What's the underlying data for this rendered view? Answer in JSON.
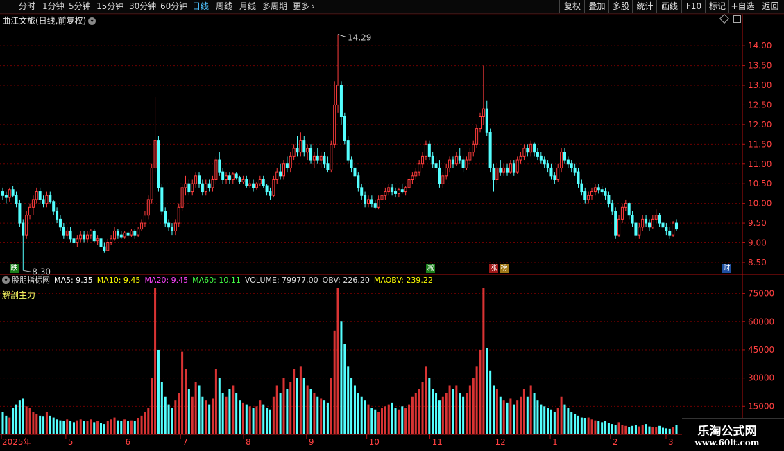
{
  "toolbar": {
    "periods": [
      {
        "label": "分时",
        "active": false
      },
      {
        "label": "1分钟",
        "active": false
      },
      {
        "label": "5分钟",
        "active": false
      },
      {
        "label": "15分钟",
        "active": false
      },
      {
        "label": "30分钟",
        "active": false
      },
      {
        "label": "60分钟",
        "active": false
      },
      {
        "label": "日线",
        "active": true
      },
      {
        "label": "周线",
        "active": false
      },
      {
        "label": "月线",
        "active": false
      },
      {
        "label": "多周期",
        "active": false
      },
      {
        "label": "更多",
        "active": false
      }
    ],
    "more_arrow": "›",
    "right_buttons": [
      "复权",
      "叠加",
      "多股",
      "统计",
      "画线",
      "F10",
      "标记",
      "+自选",
      "返回"
    ]
  },
  "stock": {
    "title": "曲江文旅(日线,前复权)"
  },
  "price_pane": {
    "y_ticks": [
      "14.00",
      "13.50",
      "13.00",
      "12.50",
      "12.00",
      "11.50",
      "11.00",
      "10.50",
      "10.00",
      "9.50",
      "9.00",
      "8.50"
    ],
    "high_label": "14.29",
    "low_label": "8.30"
  },
  "event_markers": [
    {
      "text": "跌",
      "color": "#1a7d1a"
    },
    {
      "text": "减",
      "color": "#1a7d1a"
    },
    {
      "text": "涨",
      "color": "#a01818"
    },
    {
      "text": "榜",
      "color": "#a07818"
    },
    {
      "text": "财",
      "color": "#1f4fa0"
    }
  ],
  "indicator": {
    "name": "股朋指标网",
    "ma5": "MA5: 9.35",
    "ma10": "MA10: 9.45",
    "ma20": "MA20: 9.45",
    "ma60": "MA60: 10.11",
    "volume": "VOLUME: 79977.00",
    "obv": "OBV: 226.20",
    "maobv": "MAOBV: 239.22",
    "sub_label": "解剖主力",
    "colors": {
      "ma5": "#ffffff",
      "ma10": "#ffff00",
      "ma20": "#ff44ff",
      "ma60": "#44ff44",
      "text": "#dddddd"
    }
  },
  "volume_pane": {
    "y_ticks": [
      "75000",
      "60000",
      "45000",
      "30000",
      "15000"
    ]
  },
  "x_axis": {
    "labels": [
      "2025年",
      "5",
      "6",
      "7",
      "8",
      "9",
      "10",
      "11",
      "12",
      "1",
      "2",
      "3"
    ]
  },
  "watermark": {
    "title": "乐淘公式网",
    "url": "www.60lt.com"
  },
  "colors": {
    "up": "#ff3c3c",
    "up_fill": "#000000",
    "down": "#54ffff",
    "grid": "#6e0000",
    "axis": "#b01010",
    "axis_text": "#ff4040"
  },
  "chart_data": {
    "type": "candlestick",
    "y_range": [
      8.2,
      14.6
    ],
    "volume_range": [
      0,
      80000
    ],
    "candles": [
      [
        10.3,
        10.4,
        10.1,
        10.2
      ],
      [
        10.2,
        10.3,
        10.0,
        10.15
      ],
      [
        10.15,
        10.4,
        10.05,
        10.35
      ],
      [
        10.35,
        10.45,
        10.15,
        10.2
      ],
      [
        10.2,
        10.3,
        9.9,
        10.0
      ],
      [
        10.0,
        10.1,
        9.4,
        9.5
      ],
      [
        9.5,
        9.6,
        8.3,
        9.2
      ],
      [
        9.2,
        9.8,
        9.1,
        9.7
      ],
      [
        9.7,
        10.0,
        9.6,
        9.9
      ],
      [
        9.9,
        10.2,
        9.7,
        10.1
      ],
      [
        10.1,
        10.4,
        10.0,
        10.3
      ],
      [
        10.3,
        10.4,
        10.0,
        10.1
      ],
      [
        10.1,
        10.2,
        9.9,
        10.0
      ],
      [
        10.0,
        10.3,
        9.9,
        10.2
      ],
      [
        10.2,
        10.3,
        10.0,
        10.05
      ],
      [
        10.05,
        10.1,
        9.7,
        9.8
      ],
      [
        9.8,
        9.9,
        9.5,
        9.6
      ],
      [
        9.6,
        9.7,
        9.3,
        9.4
      ],
      [
        9.4,
        9.5,
        9.1,
        9.2
      ],
      [
        9.2,
        9.4,
        9.1,
        9.3
      ],
      [
        9.3,
        9.4,
        9.0,
        9.1
      ],
      [
        9.1,
        9.2,
        8.9,
        9.0
      ],
      [
        9.0,
        9.2,
        8.9,
        9.1
      ],
      [
        9.1,
        9.3,
        9.0,
        9.2
      ],
      [
        9.2,
        9.3,
        9.0,
        9.1
      ],
      [
        9.1,
        9.3,
        9.0,
        9.2
      ],
      [
        9.2,
        9.35,
        9.1,
        9.3
      ],
      [
        9.3,
        9.35,
        9.0,
        9.05
      ],
      [
        9.05,
        9.2,
        8.95,
        9.1
      ],
      [
        9.1,
        9.2,
        8.8,
        8.9
      ],
      [
        8.9,
        9.0,
        8.75,
        8.8
      ],
      [
        8.8,
        9.1,
        8.8,
        9.0
      ],
      [
        9.0,
        9.2,
        8.95,
        9.1
      ],
      [
        9.1,
        9.4,
        9.05,
        9.3
      ],
      [
        9.3,
        9.35,
        9.1,
        9.2
      ],
      [
        9.2,
        9.3,
        9.1,
        9.15
      ],
      [
        9.15,
        9.3,
        9.1,
        9.25
      ],
      [
        9.25,
        9.3,
        9.1,
        9.2
      ],
      [
        9.2,
        9.35,
        9.15,
        9.3
      ],
      [
        9.3,
        9.35,
        9.1,
        9.2
      ],
      [
        9.2,
        9.4,
        9.15,
        9.35
      ],
      [
        9.35,
        9.6,
        9.3,
        9.5
      ],
      [
        9.5,
        9.8,
        9.4,
        9.7
      ],
      [
        9.7,
        10.2,
        9.6,
        10.1
      ],
      [
        10.1,
        11.0,
        10.0,
        10.9
      ],
      [
        10.9,
        12.7,
        10.8,
        11.6
      ],
      [
        11.6,
        11.7,
        10.3,
        10.4
      ],
      [
        10.4,
        10.5,
        9.7,
        9.8
      ],
      [
        9.8,
        9.9,
        9.4,
        9.5
      ],
      [
        9.5,
        9.6,
        9.3,
        9.4
      ],
      [
        9.4,
        9.5,
        9.2,
        9.3
      ],
      [
        9.3,
        9.6,
        9.2,
        9.5
      ],
      [
        9.5,
        10.0,
        9.4,
        9.9
      ],
      [
        9.9,
        10.5,
        9.8,
        10.4
      ],
      [
        10.4,
        10.7,
        10.2,
        10.5
      ],
      [
        10.5,
        10.6,
        10.2,
        10.3
      ],
      [
        10.3,
        10.6,
        10.2,
        10.5
      ],
      [
        10.5,
        10.8,
        10.4,
        10.7
      ],
      [
        10.7,
        10.8,
        10.4,
        10.5
      ],
      [
        10.5,
        10.6,
        10.2,
        10.3
      ],
      [
        10.3,
        10.6,
        10.2,
        10.5
      ],
      [
        10.5,
        10.6,
        10.3,
        10.4
      ],
      [
        10.4,
        10.7,
        10.3,
        10.6
      ],
      [
        10.6,
        11.2,
        10.5,
        11.1
      ],
      [
        11.1,
        11.3,
        10.7,
        10.8
      ],
      [
        10.8,
        10.9,
        10.5,
        10.6
      ],
      [
        10.6,
        10.8,
        10.5,
        10.7
      ],
      [
        10.7,
        10.8,
        10.5,
        10.6
      ],
      [
        10.6,
        10.8,
        10.5,
        10.75
      ],
      [
        10.75,
        10.8,
        10.6,
        10.65
      ],
      [
        10.65,
        10.7,
        10.5,
        10.55
      ],
      [
        10.55,
        10.7,
        10.5,
        10.6
      ],
      [
        10.6,
        10.7,
        10.4,
        10.45
      ],
      [
        10.45,
        10.6,
        10.4,
        10.5
      ],
      [
        10.5,
        10.6,
        10.3,
        10.4
      ],
      [
        10.4,
        10.55,
        10.35,
        10.5
      ],
      [
        10.5,
        10.7,
        10.45,
        10.6
      ],
      [
        10.6,
        10.7,
        10.4,
        10.45
      ],
      [
        10.45,
        10.5,
        10.2,
        10.3
      ],
      [
        10.3,
        10.4,
        10.1,
        10.2
      ],
      [
        10.2,
        10.7,
        10.15,
        10.6
      ],
      [
        10.6,
        10.9,
        10.5,
        10.8
      ],
      [
        10.8,
        11.0,
        10.6,
        10.7
      ],
      [
        10.7,
        11.1,
        10.6,
        11.0
      ],
      [
        11.0,
        11.2,
        10.8,
        10.9
      ],
      [
        10.9,
        11.3,
        10.8,
        11.2
      ],
      [
        11.2,
        11.5,
        11.1,
        11.4
      ],
      [
        11.4,
        11.7,
        11.2,
        11.3
      ],
      [
        11.3,
        11.8,
        11.2,
        11.6
      ],
      [
        11.6,
        11.7,
        11.2,
        11.3
      ],
      [
        11.3,
        11.5,
        11.1,
        11.4
      ],
      [
        11.4,
        11.5,
        11.0,
        11.1
      ],
      [
        11.1,
        11.3,
        10.9,
        11.2
      ],
      [
        11.2,
        11.4,
        11.0,
        11.1
      ],
      [
        11.1,
        11.3,
        10.9,
        11.2
      ],
      [
        11.2,
        11.3,
        10.9,
        11.0
      ],
      [
        11.0,
        11.2,
        10.8,
        10.85
      ],
      [
        10.85,
        11.6,
        10.8,
        11.5
      ],
      [
        11.5,
        13.1,
        11.4,
        12.5
      ],
      [
        12.5,
        14.29,
        12.3,
        13.0
      ],
      [
        13.0,
        13.1,
        12.0,
        12.2
      ],
      [
        12.2,
        12.3,
        11.5,
        11.6
      ],
      [
        11.6,
        11.7,
        11.0,
        11.1
      ],
      [
        11.1,
        11.2,
        10.8,
        10.9
      ],
      [
        10.9,
        11.0,
        10.6,
        10.7
      ],
      [
        10.7,
        10.8,
        10.3,
        10.4
      ],
      [
        10.4,
        10.5,
        10.1,
        10.2
      ],
      [
        10.2,
        10.3,
        9.9,
        10.0
      ],
      [
        10.0,
        10.2,
        9.9,
        10.1
      ],
      [
        10.1,
        10.2,
        9.9,
        10.0
      ],
      [
        10.0,
        10.1,
        9.85,
        9.9
      ],
      [
        9.9,
        10.2,
        9.85,
        10.1
      ],
      [
        10.1,
        10.3,
        10.0,
        10.2
      ],
      [
        10.2,
        10.4,
        10.1,
        10.3
      ],
      [
        10.3,
        10.5,
        10.2,
        10.4
      ],
      [
        10.4,
        10.5,
        10.2,
        10.3
      ],
      [
        10.3,
        10.4,
        10.15,
        10.25
      ],
      [
        10.25,
        10.4,
        10.15,
        10.35
      ],
      [
        10.35,
        10.5,
        10.25,
        10.3
      ],
      [
        10.3,
        10.45,
        10.2,
        10.4
      ],
      [
        10.4,
        10.7,
        10.35,
        10.6
      ],
      [
        10.6,
        10.8,
        10.5,
        10.7
      ],
      [
        10.7,
        10.9,
        10.6,
        10.8
      ],
      [
        10.8,
        11.1,
        10.7,
        11.0
      ],
      [
        11.0,
        11.3,
        10.9,
        11.2
      ],
      [
        11.2,
        11.6,
        11.1,
        11.5
      ],
      [
        11.5,
        11.6,
        11.1,
        11.2
      ],
      [
        11.2,
        11.3,
        10.9,
        11.0
      ],
      [
        11.0,
        11.2,
        10.8,
        10.9
      ],
      [
        10.9,
        11.1,
        10.4,
        10.5
      ],
      [
        10.5,
        10.8,
        10.4,
        10.7
      ],
      [
        10.7,
        11.0,
        10.6,
        10.9
      ],
      [
        10.9,
        11.2,
        10.8,
        11.1
      ],
      [
        11.1,
        11.2,
        10.9,
        11.0
      ],
      [
        11.0,
        11.3,
        10.95,
        11.2
      ],
      [
        11.2,
        11.4,
        11.0,
        11.1
      ],
      [
        11.1,
        11.2,
        10.8,
        10.9
      ],
      [
        10.9,
        11.2,
        10.85,
        11.1
      ],
      [
        11.1,
        11.4,
        11.0,
        11.3
      ],
      [
        11.3,
        11.6,
        11.2,
        11.5
      ],
      [
        11.5,
        12.0,
        11.4,
        11.9
      ],
      [
        11.9,
        12.3,
        11.8,
        12.2
      ],
      [
        12.2,
        13.5,
        12.0,
        12.4
      ],
      [
        12.4,
        12.6,
        11.7,
        11.8
      ],
      [
        11.8,
        11.9,
        10.8,
        10.9
      ],
      [
        10.9,
        11.0,
        10.3,
        10.6
      ],
      [
        10.6,
        11.0,
        10.5,
        10.9
      ],
      [
        10.9,
        11.1,
        10.7,
        10.8
      ],
      [
        10.8,
        11.0,
        10.7,
        10.9
      ],
      [
        10.9,
        11.0,
        10.7,
        10.8
      ],
      [
        10.8,
        11.1,
        10.75,
        11.0
      ],
      [
        11.0,
        11.1,
        10.7,
        10.8
      ],
      [
        10.8,
        11.2,
        10.75,
        11.1
      ],
      [
        11.1,
        11.3,
        11.0,
        11.2
      ],
      [
        11.2,
        11.5,
        11.1,
        11.4
      ],
      [
        11.4,
        11.5,
        11.2,
        11.3
      ],
      [
        11.3,
        11.6,
        11.2,
        11.5
      ],
      [
        11.5,
        11.55,
        11.2,
        11.3
      ],
      [
        11.3,
        11.4,
        11.1,
        11.2
      ],
      [
        11.2,
        11.3,
        11.0,
        11.1
      ],
      [
        11.1,
        11.2,
        10.9,
        11.0
      ],
      [
        11.0,
        11.1,
        10.8,
        10.9
      ],
      [
        10.9,
        11.0,
        10.6,
        10.7
      ],
      [
        10.7,
        10.8,
        10.5,
        10.6
      ],
      [
        10.6,
        11.0,
        10.55,
        10.9
      ],
      [
        10.9,
        11.4,
        10.8,
        11.3
      ],
      [
        11.3,
        11.4,
        11.0,
        11.1
      ],
      [
        11.1,
        11.2,
        10.9,
        11.0
      ],
      [
        11.0,
        11.1,
        10.8,
        10.9
      ],
      [
        10.9,
        11.0,
        10.7,
        10.8
      ],
      [
        10.8,
        10.9,
        10.4,
        10.5
      ],
      [
        10.5,
        10.6,
        10.2,
        10.3
      ],
      [
        10.3,
        10.4,
        10.0,
        10.1
      ],
      [
        10.1,
        10.3,
        10.0,
        10.2
      ],
      [
        10.2,
        10.4,
        10.1,
        10.3
      ],
      [
        10.3,
        10.5,
        10.2,
        10.4
      ],
      [
        10.4,
        10.5,
        10.25,
        10.35
      ],
      [
        10.35,
        10.45,
        10.2,
        10.3
      ],
      [
        10.3,
        10.4,
        10.1,
        10.2
      ],
      [
        10.2,
        10.3,
        9.9,
        10.0
      ],
      [
        10.0,
        10.1,
        9.7,
        9.8
      ],
      [
        9.8,
        9.9,
        9.1,
        9.2
      ],
      [
        9.2,
        9.7,
        9.15,
        9.6
      ],
      [
        9.6,
        10.0,
        9.5,
        9.9
      ],
      [
        9.9,
        10.1,
        9.8,
        10.0
      ],
      [
        10.0,
        10.05,
        9.6,
        9.7
      ],
      [
        9.7,
        9.8,
        9.4,
        9.5
      ],
      [
        9.5,
        9.6,
        9.1,
        9.2
      ],
      [
        9.2,
        9.5,
        9.1,
        9.4
      ],
      [
        9.4,
        9.7,
        9.3,
        9.6
      ],
      [
        9.6,
        9.7,
        9.4,
        9.5
      ],
      [
        9.5,
        9.6,
        9.3,
        9.4
      ],
      [
        9.4,
        9.7,
        9.35,
        9.6
      ],
      [
        9.6,
        9.85,
        9.5,
        9.7
      ],
      [
        9.7,
        9.75,
        9.4,
        9.5
      ],
      [
        9.5,
        9.6,
        9.3,
        9.4
      ],
      [
        9.4,
        9.5,
        9.2,
        9.3
      ],
      [
        9.3,
        9.4,
        9.1,
        9.2
      ],
      [
        9.2,
        9.55,
        9.15,
        9.5
      ],
      [
        9.5,
        9.6,
        9.3,
        9.35
      ]
    ],
    "volumes": [
      12000,
      10000,
      9000,
      14000,
      16000,
      18000,
      19000,
      15000,
      14000,
      12000,
      11000,
      10000,
      9500,
      12000,
      10000,
      9000,
      8000,
      7500,
      7000,
      8000,
      7000,
      6500,
      7500,
      8000,
      7000,
      7200,
      8000,
      6500,
      7000,
      6000,
      5500,
      7000,
      8000,
      9000,
      7500,
      7000,
      8000,
      7000,
      7500,
      7000,
      8500,
      10000,
      12000,
      14000,
      30000,
      78000,
      45000,
      28000,
      20000,
      16000,
      14000,
      18000,
      22000,
      44000,
      35000,
      24000,
      20000,
      28000,
      26000,
      20000,
      18000,
      16000,
      19000,
      35000,
      30000,
      22000,
      20000,
      24000,
      26000,
      22000,
      18000,
      17000,
      16000,
      15000,
      14000,
      15000,
      18000,
      16000,
      14000,
      13000,
      20000,
      26000,
      22000,
      30000,
      24000,
      28000,
      35000,
      30000,
      36000,
      30000,
      26000,
      24000,
      22000,
      20000,
      19000,
      18000,
      17000,
      30000,
      55000,
      78000,
      60000,
      48000,
      36000,
      30000,
      26000,
      22000,
      20000,
      18000,
      16000,
      14000,
      13000,
      12000,
      14000,
      15000,
      16000,
      17000,
      14000,
      13000,
      15000,
      14000,
      16000,
      20000,
      22000,
      24000,
      28000,
      36000,
      30000,
      24000,
      22000,
      18000,
      20000,
      22000,
      26000,
      24000,
      26000,
      22000,
      20000,
      22000,
      26000,
      30000,
      36000,
      45000,
      78000,
      46000,
      34000,
      26000,
      24000,
      20000,
      18000,
      17000,
      19000,
      16000,
      18000,
      20000,
      24000,
      20000,
      26000,
      22000,
      18000,
      16000,
      15000,
      14000,
      13000,
      12000,
      14000,
      20000,
      16000,
      14000,
      12000,
      11000,
      10000,
      9000,
      8500,
      9000,
      8000,
      7500,
      7000,
      6500,
      7000,
      6000,
      5500,
      5000,
      6500,
      5000,
      4500,
      4000,
      4500,
      5000,
      4200,
      4800,
      5500,
      4200,
      3800,
      4000,
      4500,
      3500,
      3200,
      3000,
      4000,
      4800,
      3500
    ]
  }
}
